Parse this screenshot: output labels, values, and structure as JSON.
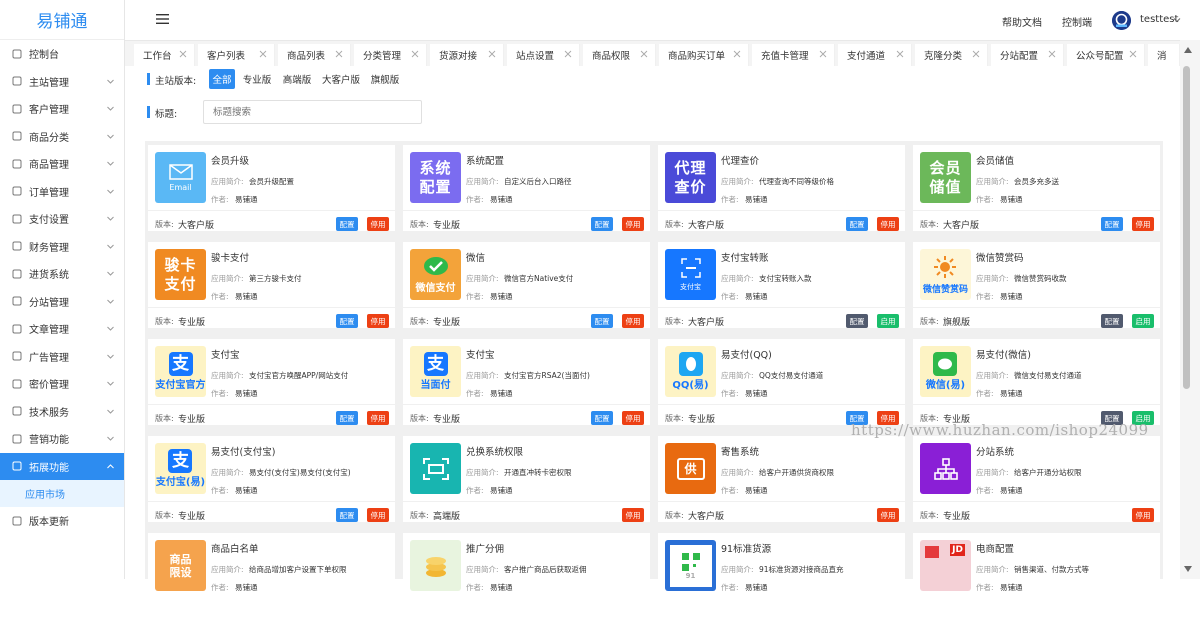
{
  "app": {
    "logo": "易铺通"
  },
  "sidebar": {
    "items": [
      {
        "label": "控制台",
        "icon": "dashboard-icon",
        "chevron": false
      },
      {
        "label": "主站管理",
        "icon": "settings-icon",
        "chevron": true
      },
      {
        "label": "客户管理",
        "icon": "user-icon",
        "chevron": true
      },
      {
        "label": "商品分类",
        "icon": "list-icon",
        "chevron": true
      },
      {
        "label": "商品管理",
        "icon": "bag-icon",
        "chevron": true
      },
      {
        "label": "订单管理",
        "icon": "order-icon",
        "chevron": true
      },
      {
        "label": "支付设置",
        "icon": "wallet-icon",
        "chevron": true
      },
      {
        "label": "财务管理",
        "icon": "chart-icon",
        "chevron": true
      },
      {
        "label": "进货系统",
        "icon": "cart-icon",
        "chevron": true
      },
      {
        "label": "分站管理",
        "icon": "monitor-icon",
        "chevron": true
      },
      {
        "label": "文章管理",
        "icon": "doc-icon",
        "chevron": true
      },
      {
        "label": "广告管理",
        "icon": "megaphone-icon",
        "chevron": true
      },
      {
        "label": "密价管理",
        "icon": "tag-icon",
        "chevron": true
      },
      {
        "label": "技术服务",
        "icon": "headset-icon",
        "chevron": true
      },
      {
        "label": "营销功能",
        "icon": "display-icon",
        "chevron": true
      },
      {
        "label": "拓展功能",
        "icon": "extension-icon",
        "chevron": true,
        "active": true
      }
    ],
    "sub_item": "应用市场",
    "bottom_item": "版本更新"
  },
  "header": {
    "help_label": "帮助文档",
    "console_label": "控制端",
    "username": "testtest"
  },
  "tabs": [
    "工作台",
    "客户列表",
    "商品列表",
    "分类管理",
    "货源对接",
    "站点设置",
    "商品权限",
    "商品购买订单",
    "充值卡管理",
    "支付通道",
    "克隆分类",
    "分站配置",
    "公众号配置",
    "消"
  ],
  "filters": {
    "version_label": "主站版本:",
    "versions": [
      "全部",
      "专业版",
      "高端版",
      "大客户版",
      "旗舰版"
    ],
    "selected": "全部",
    "title_label": "标题:",
    "search_placeholder": "标题搜索"
  },
  "cards_common": {
    "desc_label": "应用简介:",
    "author_label": "作者:",
    "version_label": "版本:"
  },
  "cards": [
    {
      "name": "会员升级",
      "desc": "会员升级配置",
      "author": "易铺通",
      "version": "大客户版",
      "icon": "email-icon",
      "icon_text": "Email",
      "color": "#5ab8f5",
      "buttons": [
        {
          "label": "配置",
          "style": "blue"
        },
        {
          "label": "停用",
          "style": "red"
        }
      ]
    },
    {
      "name": "系统配置",
      "desc": "自定义后台入口路径",
      "author": "易铺通",
      "version": "专业版",
      "icon": "system-config-icon",
      "icon_text": "系统配置",
      "color": "#7b6cf0",
      "buttons": [
        {
          "label": "配置",
          "style": "blue"
        },
        {
          "label": "停用",
          "style": "red"
        }
      ]
    },
    {
      "name": "代理查价",
      "desc": "代理查询不同等级价格",
      "author": "易铺通",
      "version": "大客户版",
      "icon": "agent-price-icon",
      "icon_text": "代理查价",
      "color": "#4a4ad8",
      "buttons": [
        {
          "label": "配置",
          "style": "blue"
        },
        {
          "label": "停用",
          "style": "red"
        }
      ]
    },
    {
      "name": "会员储值",
      "desc": "会员多充多送",
      "author": "易铺通",
      "version": "大客户版",
      "icon": "member-recharge-icon",
      "icon_text": "会员储值",
      "color": "#6cb85a",
      "buttons": [
        {
          "label": "配置",
          "style": "blue"
        },
        {
          "label": "停用",
          "style": "red"
        }
      ]
    },
    {
      "name": "骏卡支付",
      "desc": "第三方骏卡支付",
      "author": "易铺通",
      "version": "专业版",
      "icon": "junka-pay-icon",
      "icon_text": "骏卡支付",
      "color": "#f08a22",
      "buttons": [
        {
          "label": "配置",
          "style": "blue"
        },
        {
          "label": "停用",
          "style": "red"
        }
      ]
    },
    {
      "name": "微信",
      "desc": "微信官方Native支付",
      "author": "易铺通",
      "version": "专业版",
      "icon": "wechat-pay-icon",
      "icon_text": "微信支付",
      "color": "#f3a33a",
      "buttons": [
        {
          "label": "配置",
          "style": "blue"
        },
        {
          "label": "停用",
          "style": "red"
        }
      ]
    },
    {
      "name": "支付宝转账",
      "desc": "支付宝转账入款",
      "author": "易铺通",
      "version": "大客户版",
      "icon": "alipay-transfer-icon",
      "icon_text": "支付宝",
      "color": "#1677ff",
      "buttons": [
        {
          "label": "配置",
          "style": "dark"
        },
        {
          "label": "启用",
          "style": "green"
        }
      ]
    },
    {
      "name": "微信赞赏码",
      "desc": "微信赞赏码收款",
      "author": "易铺通",
      "version": "旗舰版",
      "icon": "wechat-appreciate-icon",
      "icon_text": "微信赞赏码",
      "color": "#fdf6d8",
      "buttons": [
        {
          "label": "配置",
          "style": "dark"
        },
        {
          "label": "启用",
          "style": "green"
        }
      ]
    },
    {
      "name": "支付宝",
      "desc": "支付宝官方唤醒APP/网站支付",
      "author": "易铺通",
      "version": "专业版",
      "icon": "alipay-icon",
      "icon_text": "支付宝官方",
      "color": "#fdf3c4",
      "buttons": [
        {
          "label": "配置",
          "style": "blue"
        },
        {
          "label": "停用",
          "style": "red"
        }
      ]
    },
    {
      "name": "支付宝",
      "desc": "支付宝官方RSA2(当面付)",
      "author": "易铺通",
      "version": "专业版",
      "icon": "alipay-f2f-icon",
      "icon_text": "当面付",
      "color": "#fdf3c4",
      "buttons": [
        {
          "label": "配置",
          "style": "blue"
        },
        {
          "label": "停用",
          "style": "red"
        }
      ]
    },
    {
      "name": "易支付(QQ)",
      "desc": "QQ支付易支付通道",
      "author": "易铺通",
      "version": "专业版",
      "icon": "qq-pay-icon",
      "icon_text": "QQ(易)",
      "color": "#fdf3c4",
      "buttons": [
        {
          "label": "配置",
          "style": "blue"
        },
        {
          "label": "停用",
          "style": "red"
        }
      ]
    },
    {
      "name": "易支付(微信)",
      "desc": "微信支付易支付通道",
      "author": "易铺通",
      "version": "专业版",
      "icon": "wechat-easy-pay-icon",
      "icon_text": "微信(易)",
      "color": "#fdf3c4",
      "buttons": [
        {
          "label": "配置",
          "style": "dark"
        },
        {
          "label": "启用",
          "style": "green"
        }
      ]
    },
    {
      "name": "易支付(支付宝)",
      "desc": "易支付(支付宝)易支付(支付宝)",
      "author": "易铺通",
      "version": "专业版",
      "icon": "alipay-easy-pay-icon",
      "icon_text": "支付宝(易)",
      "color": "#fdf3c4",
      "buttons": [
        {
          "label": "配置",
          "style": "blue"
        },
        {
          "label": "停用",
          "style": "red"
        }
      ]
    },
    {
      "name": "兑换系统权限",
      "desc": "开通直冲转卡密权限",
      "author": "易铺通",
      "version": "高端版",
      "icon": "exchange-icon",
      "icon_text": "",
      "color": "#18b5b0",
      "buttons": [
        {
          "label": "停用",
          "style": "red"
        }
      ]
    },
    {
      "name": "寄售系统",
      "desc": "给客户开通供货商权限",
      "author": "易铺通",
      "version": "大客户版",
      "icon": "consignment-icon",
      "icon_text": "供",
      "color": "#e86a10",
      "buttons": [
        {
          "label": "停用",
          "style": "red"
        }
      ]
    },
    {
      "name": "分站系统",
      "desc": "给客户开通分站权限",
      "author": "易铺通",
      "version": "专业版",
      "icon": "substation-icon",
      "icon_text": "",
      "color": "#8a1fd6",
      "buttons": [
        {
          "label": "停用",
          "style": "red"
        }
      ]
    },
    {
      "name": "商品白名单",
      "desc": "给商品增加客户设置下单权限",
      "author": "易铺通",
      "version": "",
      "icon": "whitelist-icon",
      "icon_text": "商品限设",
      "color": "#f5a34d",
      "buttons": []
    },
    {
      "name": "推广分佣",
      "desc": "客户推广商品后获取返佣",
      "author": "易铺通",
      "version": "",
      "icon": "commission-icon",
      "icon_text": "",
      "color": "#e8f4df",
      "buttons": []
    },
    {
      "name": "91标准货源",
      "desc": "91标准货源对接商品直充",
      "author": "易铺通",
      "version": "",
      "icon": "supply-91-icon",
      "icon_text": "91",
      "color": "#2a6fd6",
      "buttons": []
    },
    {
      "name": "电商配置",
      "desc": "销售渠道、付款方式等",
      "author": "易铺通",
      "version": "",
      "icon": "ecommerce-icon",
      "icon_text": "JD",
      "color": "#f4d0d6",
      "buttons": []
    }
  ],
  "watermark": "https://www.huzhan.com/ishop24099"
}
